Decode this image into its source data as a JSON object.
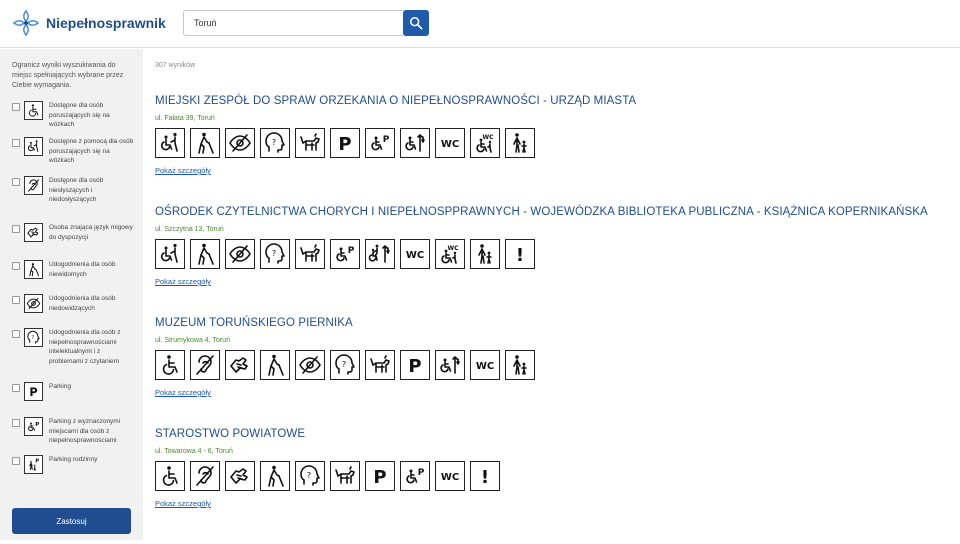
{
  "header": {
    "logo_text": "Niepełnosprawnik",
    "search_value": "Toruń"
  },
  "sidebar": {
    "intro": "Ogranicz wyniki wyszukiwania do miejsc spełniających wybrane przez Ciebie wymagania.",
    "filters": [
      {
        "label": "Dostępne dla osób poruszających się na wózkach",
        "icon": "wheelchair-icon"
      },
      {
        "label": "Dostępne z pomocą dla osób poruszających się na wózkach",
        "icon": "wheelchair-assisted-icon"
      },
      {
        "label": "Dostępne dla osób niesłyszących i niedosłyszących",
        "icon": "hearing-impaired-icon"
      },
      {
        "label": "Osoba znająca język migowy do dyspozycji",
        "icon": "sign-language-icon"
      },
      {
        "label": "Udogodnienia dla osób niewidomych",
        "icon": "blind-person-icon"
      },
      {
        "label": "Udogodnienia dla osób niedowidzących",
        "icon": "low-vision-icon"
      },
      {
        "label": "Udogodnienia dla osób z niepełnosprawnościami intelektualnymi i z problemami z czytaniem",
        "icon": "cognitive-icon"
      },
      {
        "label": "Parking",
        "icon": "parking-icon"
      },
      {
        "label": "Parking z wyznaczonymi miejscami dla osób z niepełnosprawnościami",
        "icon": "accessible-parking-icon"
      },
      {
        "label": "Parking rodzinny",
        "icon": "family-parking-icon"
      }
    ],
    "apply_label": "Zastosuj"
  },
  "results": {
    "count": "307 wyników",
    "details_label": "Pokaż szczegóły",
    "items": [
      {
        "title": "MIEJSKI ZESPÓŁ DO SPRAW ORZEKANIA O NIEPEŁNOSPRAWNOŚCI - URZĄD MIASTA",
        "address": "ul. Fałata 39, Toruń",
        "icons": [
          "wheelchair-assisted-icon",
          "blind-person-icon",
          "low-vision-icon",
          "cognitive-icon",
          "guide-dog-icon",
          "parking-icon",
          "accessible-parking-icon",
          "elevator-icon",
          "wc-icon",
          "accessible-wc-icon",
          "family-icon"
        ]
      },
      {
        "title": "OŚRODEK CZYTELNICTWA CHORYCH I NIEPEŁNOSPPRAWNYCH - WOJEWÓDZKA BIBLIOTEKA PUBLICZNA - KSIĄŻNICA KOPERNIKAŃSKA",
        "address": "ul. Szczytna 13, Toruń",
        "icons": [
          "wheelchair-assisted-icon",
          "blind-person-icon",
          "low-vision-icon",
          "cognitive-icon",
          "guide-dog-icon",
          "accessible-parking-icon",
          "elevator-assisted-icon",
          "wc-icon",
          "accessible-wc-icon",
          "family-icon",
          "exclamation-icon"
        ]
      },
      {
        "title": "MUZEUM TORUŃSKIEGO PIERNIKA",
        "address": "ul. Strumykowa 4, Toruń",
        "icons": [
          "wheelchair-icon",
          "hearing-impaired-icon",
          "sign-language-icon",
          "blind-person-icon",
          "low-vision-icon",
          "cognitive-icon",
          "guide-dog-icon",
          "parking-icon",
          "elevator-icon",
          "wc-icon",
          "family-icon"
        ]
      },
      {
        "title": "STAROSTWO POWIATOWE",
        "address": "ul. Towarowa 4 - 6, Toruń",
        "icons": [
          "wheelchair-icon",
          "hearing-impaired-icon",
          "sign-language-icon",
          "blind-person-icon",
          "cognitive-icon",
          "guide-dog-icon",
          "parking-icon",
          "accessible-parking-icon",
          "wc-icon",
          "exclamation-icon"
        ]
      }
    ]
  }
}
